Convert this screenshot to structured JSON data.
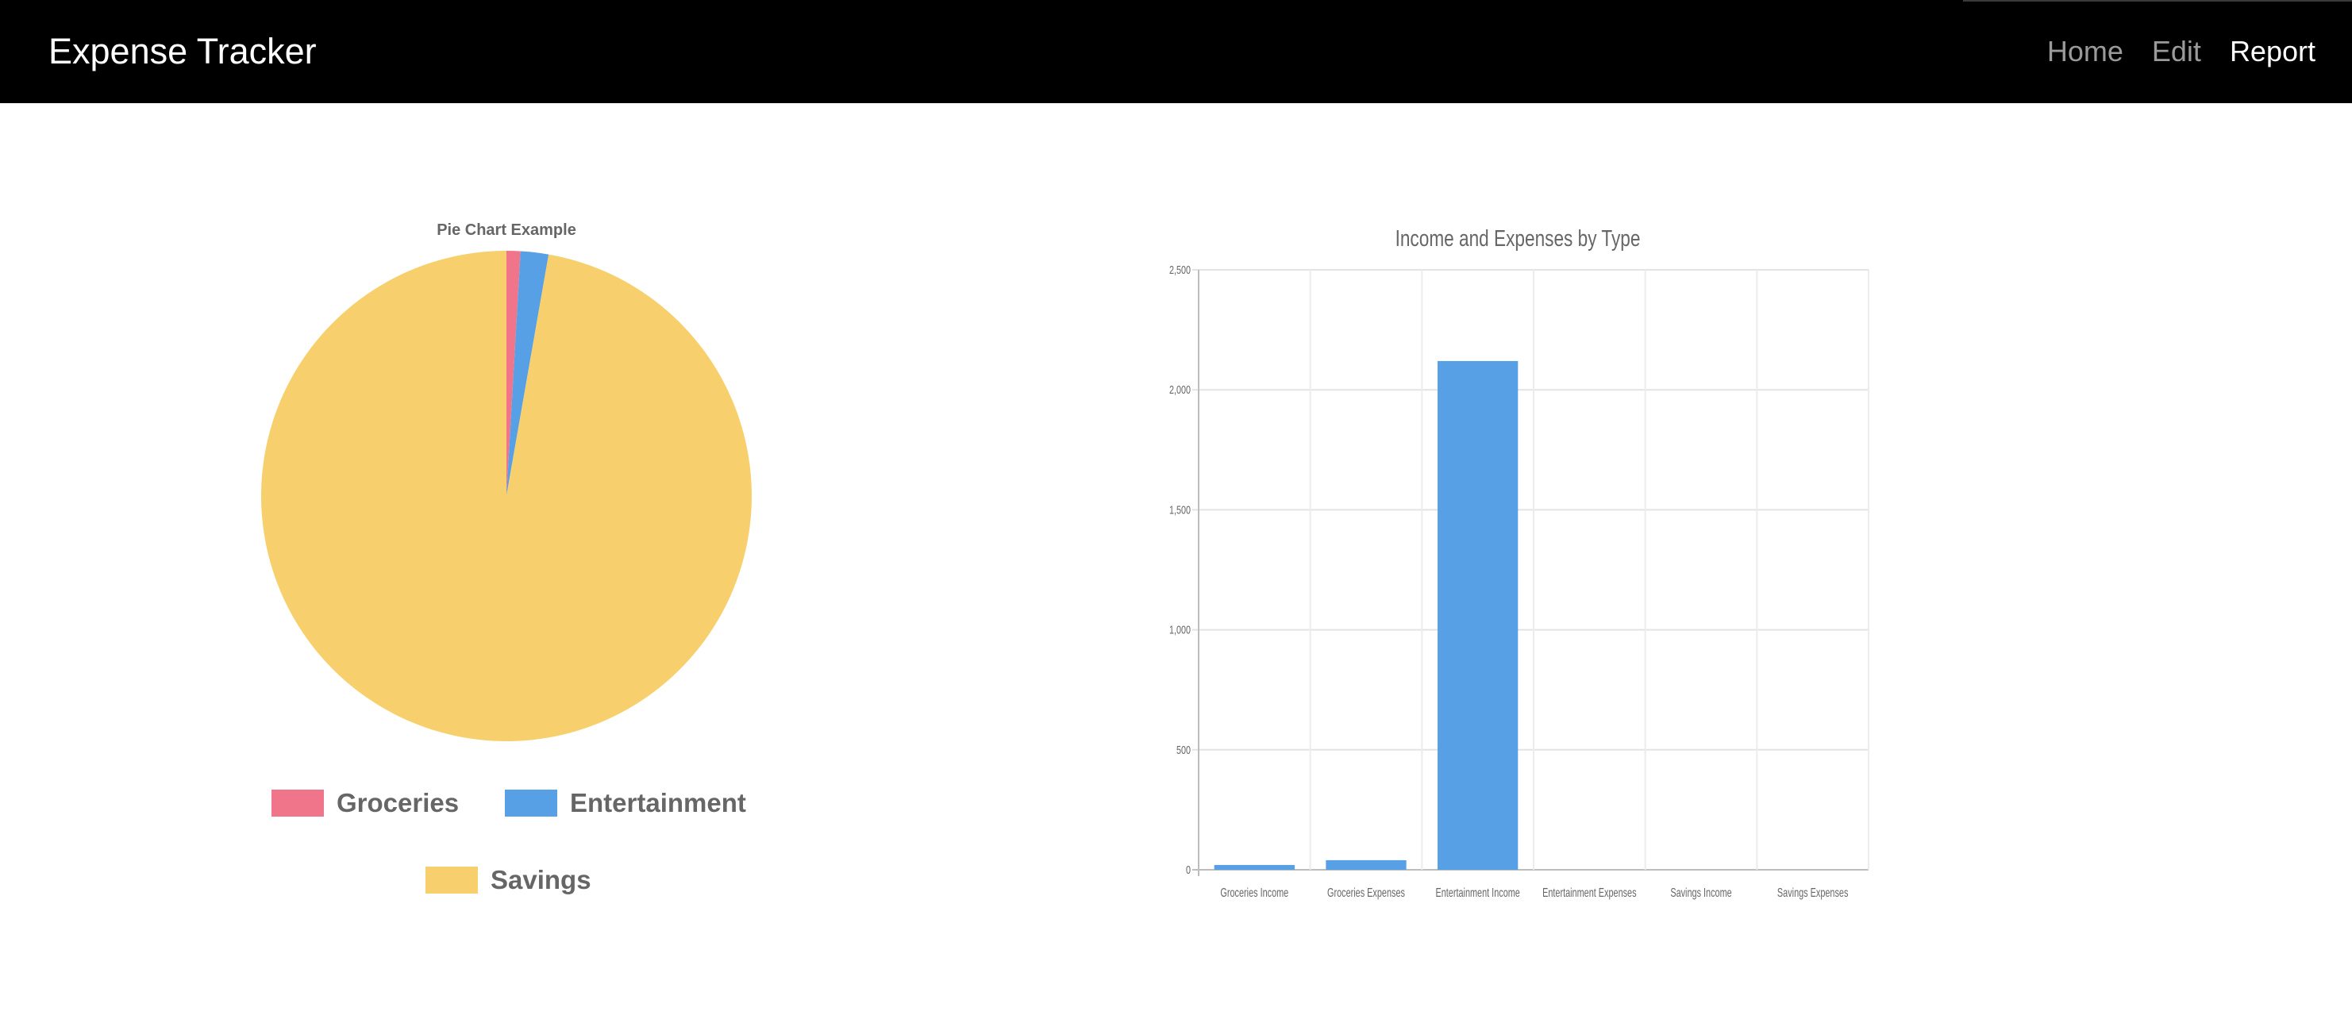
{
  "navbar": {
    "brand": "Expense Tracker",
    "links": [
      {
        "label": "Home",
        "active": false
      },
      {
        "label": "Edit",
        "active": false
      },
      {
        "label": "Report",
        "active": true
      }
    ]
  },
  "chart_data": [
    {
      "type": "pie",
      "title": "Pie Chart Example",
      "categories": [
        "Groceries",
        "Entertainment",
        "Savings"
      ],
      "values": [
        20,
        40,
        2120
      ],
      "colors": [
        "#f0758a",
        "#58a0e5",
        "#f7d06d"
      ],
      "legend": "bottom"
    },
    {
      "type": "bar",
      "title": "Income and Expenses by Type",
      "categories": [
        "Groceries Income",
        "Groceries Expenses",
        "Entertainment Income",
        "Entertainment Expenses",
        "Savings Income",
        "Savings Expenses"
      ],
      "values": [
        20,
        40,
        2120,
        0,
        0,
        0
      ],
      "color": "#58a0e5",
      "ylim": [
        0,
        2500
      ],
      "yticks": [
        "0",
        "500",
        "1,000",
        "1,500",
        "2,000",
        "2,500"
      ],
      "grid": true,
      "legend": "none"
    }
  ]
}
